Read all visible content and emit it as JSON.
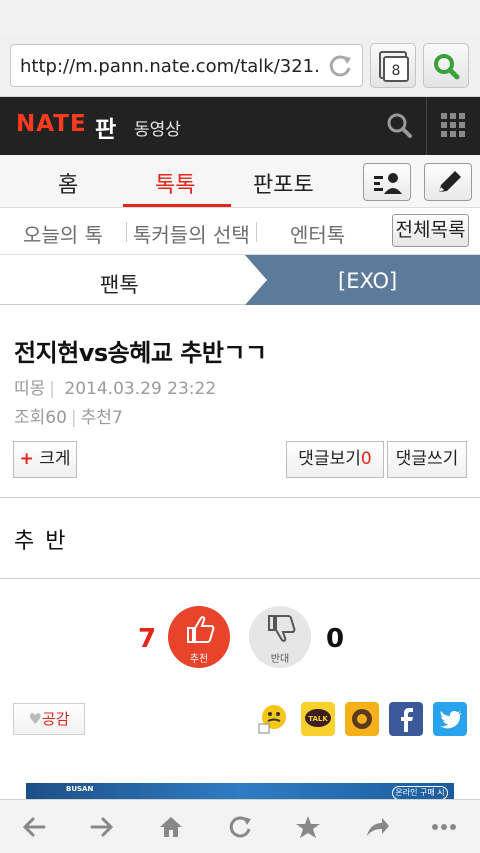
{
  "browser": {
    "url": "http://m.pann.nate.com/talk/321...",
    "tab_count": "8"
  },
  "header": {
    "logo": "NATE",
    "section": "판",
    "video_link": "동영상"
  },
  "main_tabs": [
    {
      "label": "홈",
      "active": false
    },
    {
      "label": "톡톡",
      "active": true
    },
    {
      "label": "판포토",
      "active": false
    }
  ],
  "sub_tabs": [
    {
      "label": "오늘의 톡"
    },
    {
      "label": "톡커들의 선택"
    },
    {
      "label": "엔터톡"
    }
  ],
  "all_list_label": "전체목록",
  "breadcrumb": {
    "left": "팬톡",
    "right": "[EXO]"
  },
  "article": {
    "title": "전지현vs송혜교 추반ㄱㄱ",
    "author": "띠몽",
    "date": "2014.03.29 23:22",
    "views_label": "조회",
    "views": "60",
    "recommend_label": "추천",
    "recommend": "7",
    "body": "추 반"
  },
  "actions": {
    "font_bigger": "크게",
    "view_comments": "댓글보기",
    "comment_count": "0",
    "write_comment": "댓글쓰기"
  },
  "votes": {
    "up_count": "7",
    "up_label": "추천",
    "down_count": "0",
    "down_label": "반대"
  },
  "share": {
    "like_label": "공감",
    "icons": [
      "emoticon-icon",
      "kakaotalk-icon",
      "kakaostory-icon",
      "facebook-icon",
      "twitter-icon"
    ]
  },
  "ad": {
    "brand": "BUSAN",
    "cta": "온라인 구매 시"
  },
  "colors": {
    "brand_red": "#e2261b",
    "header_bg": "#222222",
    "crumb_blue": "#5c7a99"
  }
}
